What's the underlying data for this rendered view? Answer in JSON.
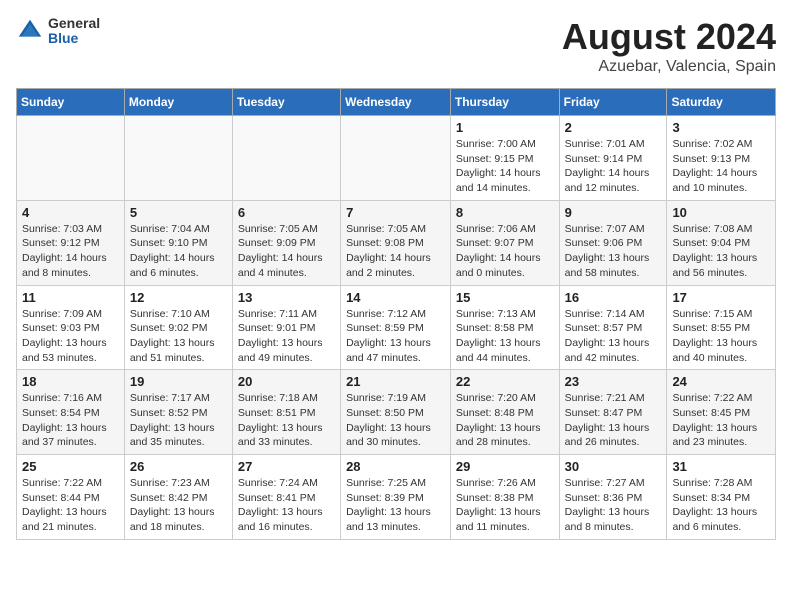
{
  "header": {
    "logo_general": "General",
    "logo_blue": "Blue",
    "title": "August 2024",
    "subtitle": "Azuebar, Valencia, Spain"
  },
  "days_of_week": [
    "Sunday",
    "Monday",
    "Tuesday",
    "Wednesday",
    "Thursday",
    "Friday",
    "Saturday"
  ],
  "weeks": [
    [
      {
        "day": "",
        "info": ""
      },
      {
        "day": "",
        "info": ""
      },
      {
        "day": "",
        "info": ""
      },
      {
        "day": "",
        "info": ""
      },
      {
        "day": "1",
        "info": "Sunrise: 7:00 AM\nSunset: 9:15 PM\nDaylight: 14 hours\nand 14 minutes."
      },
      {
        "day": "2",
        "info": "Sunrise: 7:01 AM\nSunset: 9:14 PM\nDaylight: 14 hours\nand 12 minutes."
      },
      {
        "day": "3",
        "info": "Sunrise: 7:02 AM\nSunset: 9:13 PM\nDaylight: 14 hours\nand 10 minutes."
      }
    ],
    [
      {
        "day": "4",
        "info": "Sunrise: 7:03 AM\nSunset: 9:12 PM\nDaylight: 14 hours\nand 8 minutes."
      },
      {
        "day": "5",
        "info": "Sunrise: 7:04 AM\nSunset: 9:10 PM\nDaylight: 14 hours\nand 6 minutes."
      },
      {
        "day": "6",
        "info": "Sunrise: 7:05 AM\nSunset: 9:09 PM\nDaylight: 14 hours\nand 4 minutes."
      },
      {
        "day": "7",
        "info": "Sunrise: 7:05 AM\nSunset: 9:08 PM\nDaylight: 14 hours\nand 2 minutes."
      },
      {
        "day": "8",
        "info": "Sunrise: 7:06 AM\nSunset: 9:07 PM\nDaylight: 14 hours\nand 0 minutes."
      },
      {
        "day": "9",
        "info": "Sunrise: 7:07 AM\nSunset: 9:06 PM\nDaylight: 13 hours\nand 58 minutes."
      },
      {
        "day": "10",
        "info": "Sunrise: 7:08 AM\nSunset: 9:04 PM\nDaylight: 13 hours\nand 56 minutes."
      }
    ],
    [
      {
        "day": "11",
        "info": "Sunrise: 7:09 AM\nSunset: 9:03 PM\nDaylight: 13 hours\nand 53 minutes."
      },
      {
        "day": "12",
        "info": "Sunrise: 7:10 AM\nSunset: 9:02 PM\nDaylight: 13 hours\nand 51 minutes."
      },
      {
        "day": "13",
        "info": "Sunrise: 7:11 AM\nSunset: 9:01 PM\nDaylight: 13 hours\nand 49 minutes."
      },
      {
        "day": "14",
        "info": "Sunrise: 7:12 AM\nSunset: 8:59 PM\nDaylight: 13 hours\nand 47 minutes."
      },
      {
        "day": "15",
        "info": "Sunrise: 7:13 AM\nSunset: 8:58 PM\nDaylight: 13 hours\nand 44 minutes."
      },
      {
        "day": "16",
        "info": "Sunrise: 7:14 AM\nSunset: 8:57 PM\nDaylight: 13 hours\nand 42 minutes."
      },
      {
        "day": "17",
        "info": "Sunrise: 7:15 AM\nSunset: 8:55 PM\nDaylight: 13 hours\nand 40 minutes."
      }
    ],
    [
      {
        "day": "18",
        "info": "Sunrise: 7:16 AM\nSunset: 8:54 PM\nDaylight: 13 hours\nand 37 minutes."
      },
      {
        "day": "19",
        "info": "Sunrise: 7:17 AM\nSunset: 8:52 PM\nDaylight: 13 hours\nand 35 minutes."
      },
      {
        "day": "20",
        "info": "Sunrise: 7:18 AM\nSunset: 8:51 PM\nDaylight: 13 hours\nand 33 minutes."
      },
      {
        "day": "21",
        "info": "Sunrise: 7:19 AM\nSunset: 8:50 PM\nDaylight: 13 hours\nand 30 minutes."
      },
      {
        "day": "22",
        "info": "Sunrise: 7:20 AM\nSunset: 8:48 PM\nDaylight: 13 hours\nand 28 minutes."
      },
      {
        "day": "23",
        "info": "Sunrise: 7:21 AM\nSunset: 8:47 PM\nDaylight: 13 hours\nand 26 minutes."
      },
      {
        "day": "24",
        "info": "Sunrise: 7:22 AM\nSunset: 8:45 PM\nDaylight: 13 hours\nand 23 minutes."
      }
    ],
    [
      {
        "day": "25",
        "info": "Sunrise: 7:22 AM\nSunset: 8:44 PM\nDaylight: 13 hours\nand 21 minutes."
      },
      {
        "day": "26",
        "info": "Sunrise: 7:23 AM\nSunset: 8:42 PM\nDaylight: 13 hours\nand 18 minutes."
      },
      {
        "day": "27",
        "info": "Sunrise: 7:24 AM\nSunset: 8:41 PM\nDaylight: 13 hours\nand 16 minutes."
      },
      {
        "day": "28",
        "info": "Sunrise: 7:25 AM\nSunset: 8:39 PM\nDaylight: 13 hours\nand 13 minutes."
      },
      {
        "day": "29",
        "info": "Sunrise: 7:26 AM\nSunset: 8:38 PM\nDaylight: 13 hours\nand 11 minutes."
      },
      {
        "day": "30",
        "info": "Sunrise: 7:27 AM\nSunset: 8:36 PM\nDaylight: 13 hours\nand 8 minutes."
      },
      {
        "day": "31",
        "info": "Sunrise: 7:28 AM\nSunset: 8:34 PM\nDaylight: 13 hours\nand 6 minutes."
      }
    ]
  ]
}
